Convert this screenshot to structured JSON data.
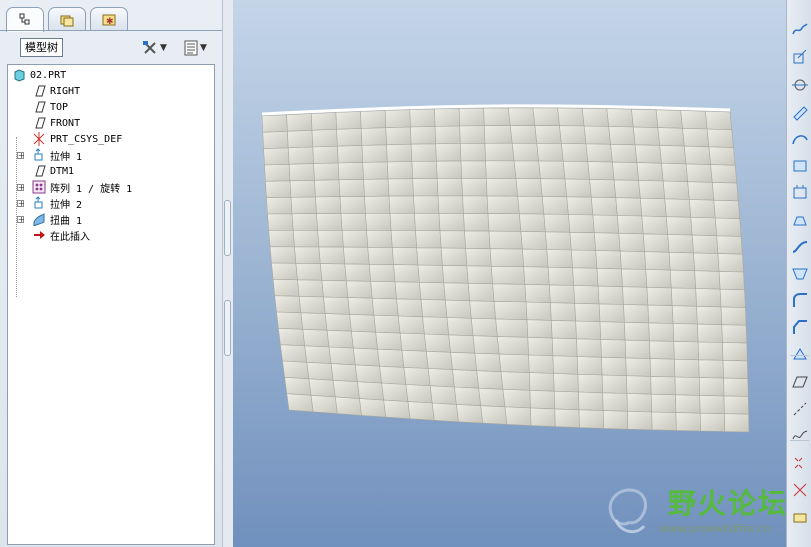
{
  "panel": {
    "tabs": [
      {
        "name": "model-tree-tab",
        "active": true
      },
      {
        "name": "folder-browser-tab",
        "active": false
      },
      {
        "name": "favorites-tab",
        "active": false
      }
    ],
    "tree_label": "模型树"
  },
  "tree": {
    "root": "02.PRT",
    "items": [
      {
        "label": "RIGHT",
        "icon": "datum-plane-icon",
        "expandable": false
      },
      {
        "label": "TOP",
        "icon": "datum-plane-icon",
        "expandable": false
      },
      {
        "label": "FRONT",
        "icon": "datum-plane-icon",
        "expandable": false
      },
      {
        "label": "PRT_CSYS_DEF",
        "icon": "csys-icon",
        "expandable": false
      },
      {
        "label": "拉伸 1",
        "icon": "extrude-icon",
        "expandable": true
      },
      {
        "label": "DTM1",
        "icon": "datum-plane-icon",
        "expandable": false
      },
      {
        "label": "阵列 1 / 旋转 1",
        "icon": "pattern-icon",
        "expandable": true
      },
      {
        "label": "拉伸 2",
        "icon": "extrude-icon",
        "expandable": true
      },
      {
        "label": "扭曲 1",
        "icon": "warp-icon",
        "expandable": true
      },
      {
        "label": "在此插入",
        "icon": "insert-here-arrow-icon",
        "expandable": false
      }
    ]
  },
  "toolbar_right": [
    "sketched-datum-icon",
    "datum-plane-tool-icon",
    "datum-axis-icon",
    "datum-point-icon",
    "datum-curve-icon",
    "csys-tool-icon",
    "extrude-tool-icon",
    "revolve-tool-icon",
    "sweep-tool-icon",
    "blend-tool-icon",
    "round-tool-icon",
    "chamfer-tool-icon",
    "draft-tool-icon",
    "plane-icon",
    "axis-line-icon",
    "curve-icon",
    "point-icon",
    "csys-small-icon",
    "analysis-icon"
  ],
  "watermark": {
    "title": "野火论坛",
    "url": "www.proewildfire.cn"
  },
  "colors": {
    "accent": "#56ba3e",
    "surface": "#d9d8cf",
    "viewport_top": "#c4d5e8",
    "viewport_bottom": "#7090bd"
  }
}
